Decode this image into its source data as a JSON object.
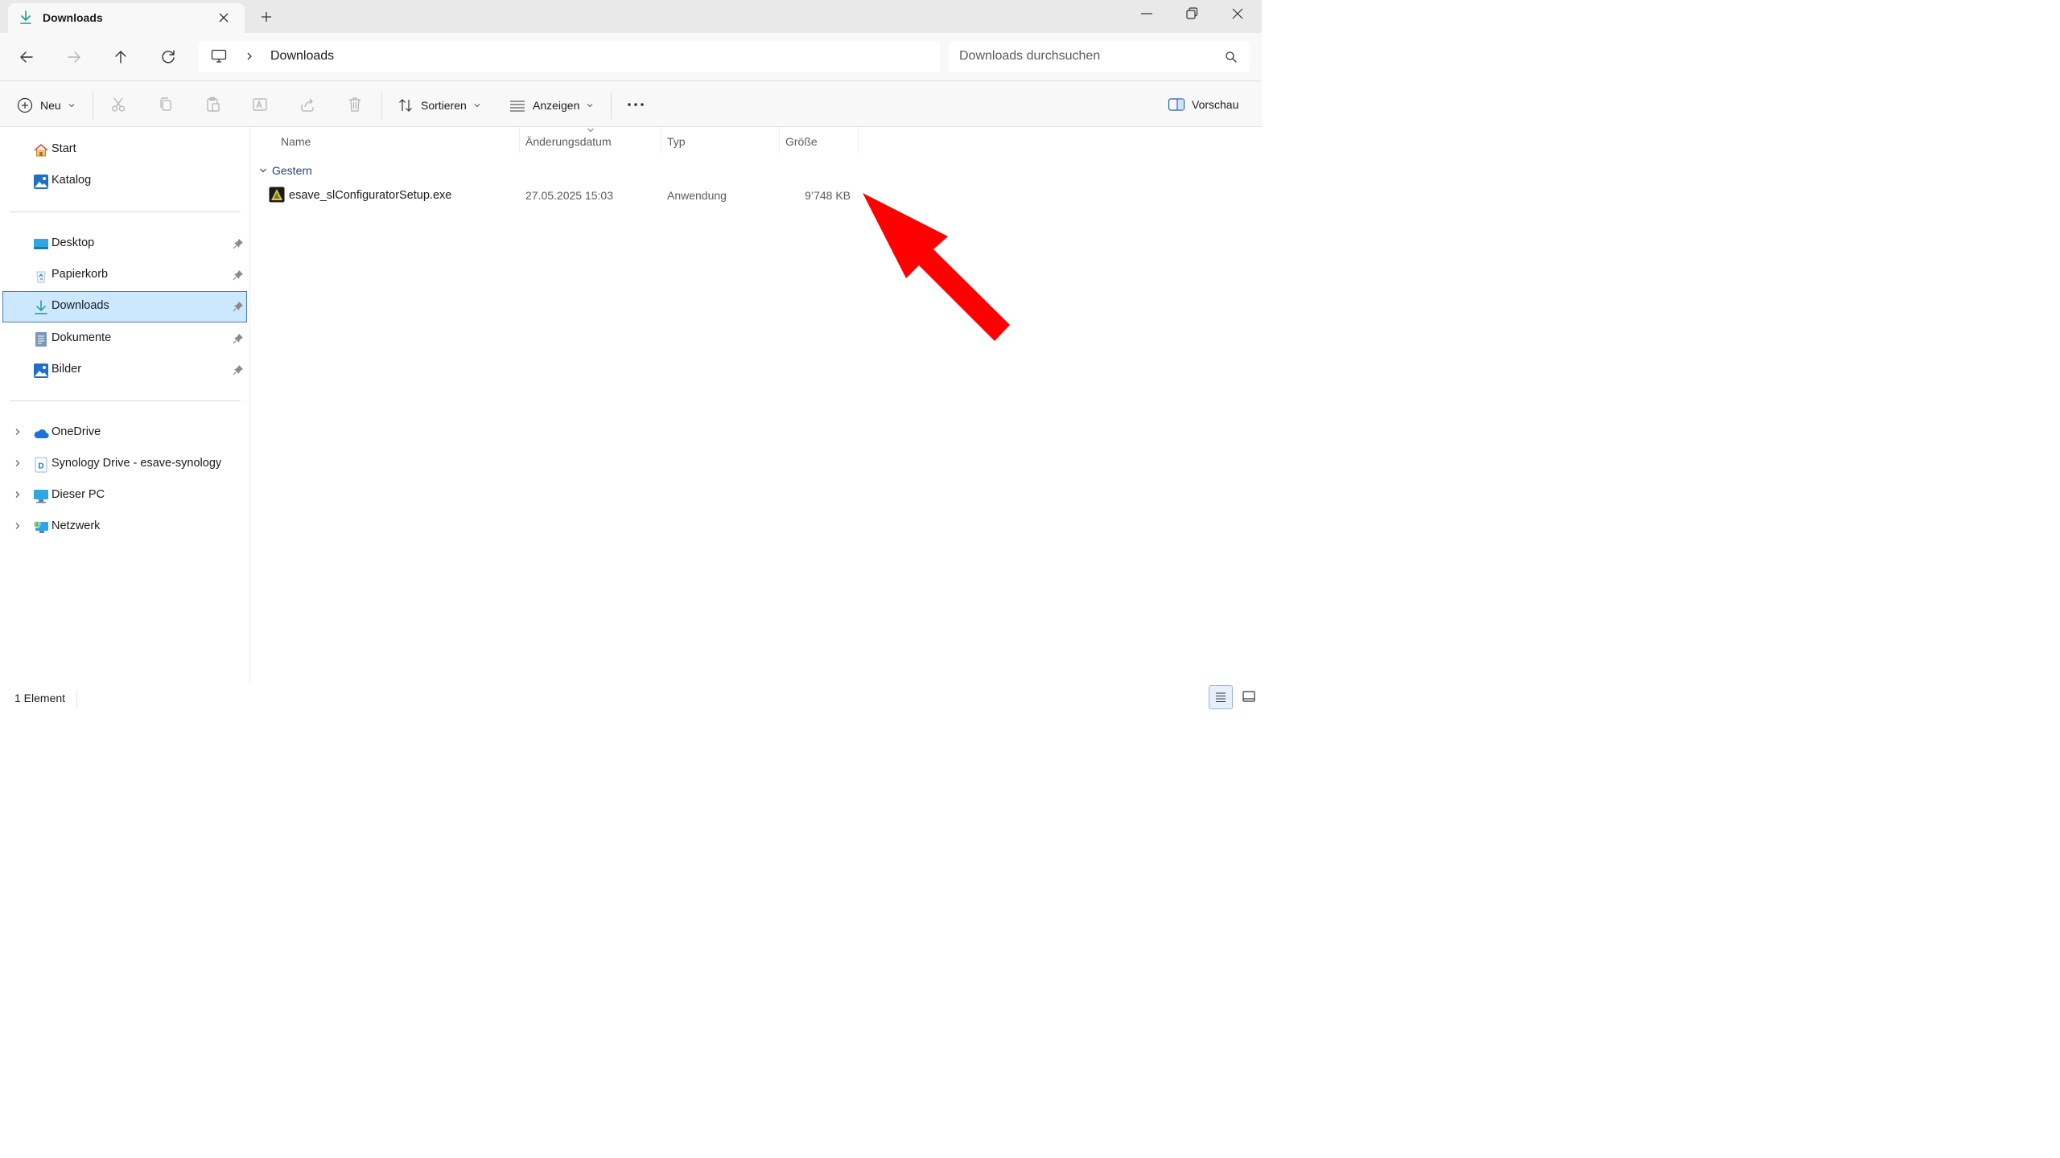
{
  "tab": {
    "title": "Downloads"
  },
  "address": {
    "current": "Downloads"
  },
  "search": {
    "placeholder": "Downloads durchsuchen"
  },
  "commandbar": {
    "new_label": "Neu",
    "sort_label": "Sortieren",
    "view_label": "Anzeigen",
    "preview_label": "Vorschau"
  },
  "sidebar": {
    "quick": [
      {
        "label": "Start",
        "icon": "home-icon"
      },
      {
        "label": "Katalog",
        "icon": "gallery-icon"
      }
    ],
    "pinned": [
      {
        "label": "Desktop",
        "icon": "desktop-icon"
      },
      {
        "label": "Papierkorb",
        "icon": "recycle-bin-icon"
      },
      {
        "label": "Downloads",
        "icon": "download-icon",
        "selected": true
      },
      {
        "label": "Dokumente",
        "icon": "document-icon"
      },
      {
        "label": "Bilder",
        "icon": "pictures-icon"
      }
    ],
    "locations": [
      {
        "label": "OneDrive",
        "icon": "cloud-icon"
      },
      {
        "label": "Synology Drive - esave-synology",
        "icon": "synology-drive-icon"
      },
      {
        "label": "Dieser PC",
        "icon": "pc-icon"
      },
      {
        "label": "Netzwerk",
        "icon": "network-icon"
      }
    ]
  },
  "columns": {
    "name": "Name",
    "date": "Änderungsdatum",
    "type": "Typ",
    "size": "Größe"
  },
  "group": {
    "label": "Gestern"
  },
  "files": [
    {
      "name": "esave_slConfiguratorSetup.exe",
      "date": "27.05.2025 15:03",
      "type": "Anwendung",
      "size": "9’748 KB"
    }
  ],
  "status": {
    "count": "1 Element"
  },
  "colors": {
    "selection_bg": "#cce8ff",
    "selection_border": "#4a7bb0",
    "annotation_arrow": "#ff0000",
    "group_label": "#1f3e7c"
  }
}
